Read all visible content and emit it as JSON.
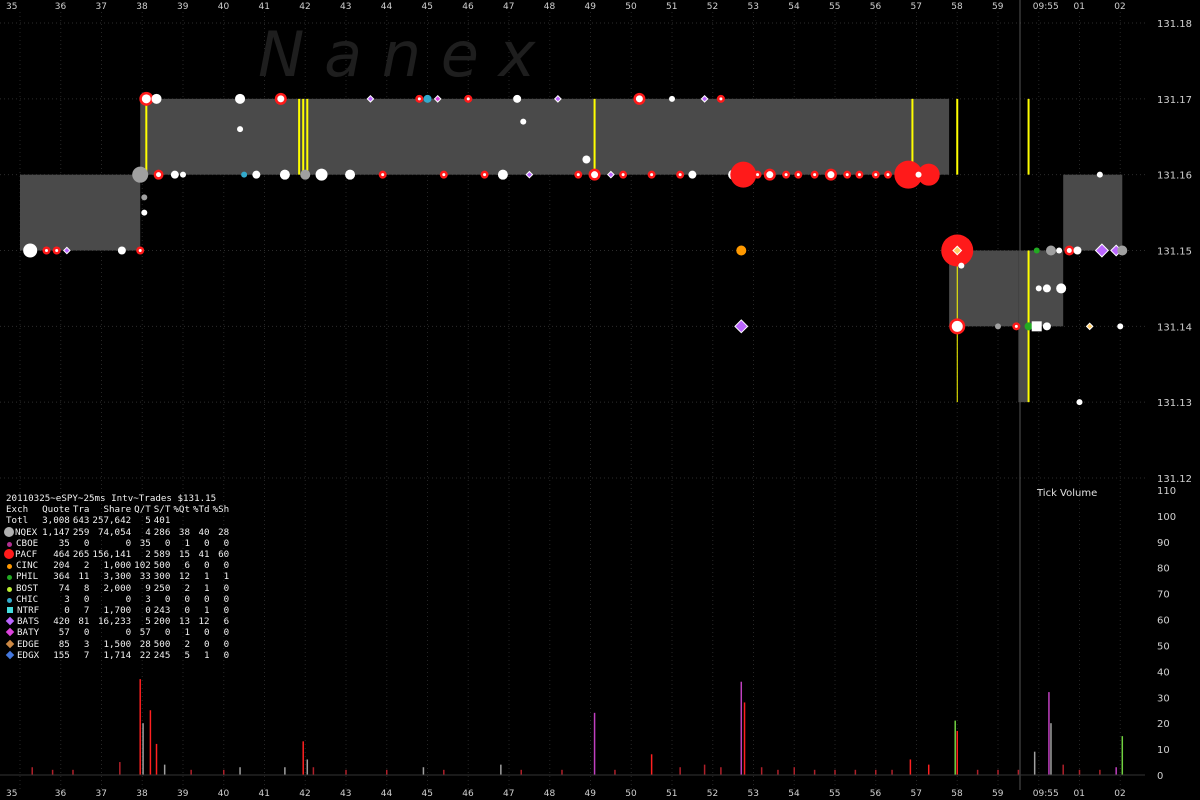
{
  "chart_data": {
    "type": "scatter",
    "watermark": "N a n e x",
    "y_price_ticks": [
      "131.18",
      "131.17",
      "131.16",
      "131.15",
      "131.14",
      "131.13",
      "131.12"
    ],
    "ylim_price": [
      131.12,
      131.18
    ],
    "x_ticks": [
      "35",
      "36",
      "37",
      "38",
      "39",
      "40",
      "41",
      "42",
      "43",
      "44",
      "45",
      "46",
      "47",
      "48",
      "49",
      "50",
      "51",
      "52",
      "53",
      "54",
      "55",
      "56",
      "57",
      "58",
      "59",
      "09:55",
      "01",
      "02"
    ],
    "y_volume_ticks": [
      "110",
      "100",
      "90",
      "80",
      "70",
      "60",
      "50",
      "40",
      "30",
      "20",
      "10",
      "0"
    ],
    "ylim_volume": [
      0,
      110
    ],
    "volume_label": "Tick Volume",
    "nbbo_bands": [
      {
        "x0": 0,
        "x1": 2.95,
        "bid": 131.15,
        "ask": 131.16
      },
      {
        "x0": 2.95,
        "x1": 22.8,
        "bid": 131.16,
        "ask": 131.17
      },
      {
        "x0": 22.8,
        "x1": 24.5,
        "bid": 131.14,
        "ask": 131.15
      },
      {
        "x0": 24.5,
        "x1": 24.75,
        "bid": 131.13,
        "ask": 131.15
      },
      {
        "x0": 24.75,
        "x1": 25.6,
        "bid": 131.14,
        "ask": 131.15
      },
      {
        "x0": 25.6,
        "x1": 27.05,
        "bid": 131.15,
        "ask": 131.16
      }
    ],
    "yellow_trades": [
      3.1,
      6.85,
      6.95,
      7.05,
      14.1,
      21.9,
      23.0,
      24.75
    ],
    "trades": [
      {
        "x": 0.25,
        "y": 131.15,
        "ex": "NQEX",
        "r": 7
      },
      {
        "x": 0.65,
        "y": 131.15,
        "ex": "PACF",
        "r": 3
      },
      {
        "x": 0.9,
        "y": 131.15,
        "ex": "PACF",
        "r": 3
      },
      {
        "x": 1.15,
        "y": 131.15,
        "ex": "BATS",
        "r": 3
      },
      {
        "x": 2.5,
        "y": 131.15,
        "ex": "NQEX",
        "r": 4
      },
      {
        "x": 2.95,
        "y": 131.15,
        "ex": "PACF",
        "r": 3
      },
      {
        "x": 2.95,
        "y": 131.16,
        "ex": "Totl",
        "r": 8
      },
      {
        "x": 3.05,
        "y": 131.157,
        "ex": "Totl",
        "r": 3
      },
      {
        "x": 3.05,
        "y": 131.155,
        "ex": "NQEX",
        "r": 3
      },
      {
        "x": 3.1,
        "y": 131.17,
        "ex": "PACF",
        "r": 6
      },
      {
        "x": 3.35,
        "y": 131.17,
        "ex": "NQEX",
        "r": 5
      },
      {
        "x": 3.4,
        "y": 131.16,
        "ex": "PACF",
        "r": 4
      },
      {
        "x": 3.8,
        "y": 131.16,
        "ex": "NQEX",
        "r": 4
      },
      {
        "x": 4.0,
        "y": 131.16,
        "ex": "NQEX",
        "r": 3
      },
      {
        "x": 5.4,
        "y": 131.17,
        "ex": "NQEX",
        "r": 5
      },
      {
        "x": 5.4,
        "y": 131.166,
        "ex": "NQEX",
        "r": 3
      },
      {
        "x": 5.5,
        "y": 131.16,
        "ex": "CHIC",
        "r": 3
      },
      {
        "x": 5.8,
        "y": 131.16,
        "ex": "NQEX",
        "r": 4
      },
      {
        "x": 6.4,
        "y": 131.17,
        "ex": "PACF",
        "r": 5
      },
      {
        "x": 6.5,
        "y": 131.16,
        "ex": "NQEX",
        "r": 5
      },
      {
        "x": 7.0,
        "y": 131.16,
        "ex": "Totl",
        "r": 5
      },
      {
        "x": 7.4,
        "y": 131.16,
        "ex": "NQEX",
        "r": 6
      },
      {
        "x": 8.1,
        "y": 131.16,
        "ex": "NQEX",
        "r": 5
      },
      {
        "x": 8.6,
        "y": 131.17,
        "ex": "BATS",
        "r": 3
      },
      {
        "x": 8.9,
        "y": 131.16,
        "ex": "PACF",
        "r": 3
      },
      {
        "x": 9.8,
        "y": 131.17,
        "ex": "PACF",
        "r": 3
      },
      {
        "x": 10.0,
        "y": 131.17,
        "ex": "CHIC",
        "r": 4
      },
      {
        "x": 10.25,
        "y": 131.17,
        "ex": "BATY",
        "r": 3
      },
      {
        "x": 10.4,
        "y": 131.16,
        "ex": "PACF",
        "r": 3
      },
      {
        "x": 11.0,
        "y": 131.17,
        "ex": "PACF",
        "r": 3
      },
      {
        "x": 11.4,
        "y": 131.16,
        "ex": "PACF",
        "r": 3
      },
      {
        "x": 11.85,
        "y": 131.16,
        "ex": "NQEX",
        "r": 5
      },
      {
        "x": 12.2,
        "y": 131.17,
        "ex": "NQEX",
        "r": 4
      },
      {
        "x": 12.35,
        "y": 131.167,
        "ex": "NQEX",
        "r": 3
      },
      {
        "x": 12.5,
        "y": 131.16,
        "ex": "BATS",
        "r": 3
      },
      {
        "x": 13.2,
        "y": 131.17,
        "ex": "BATS",
        "r": 3
      },
      {
        "x": 13.9,
        "y": 131.162,
        "ex": "NQEX",
        "r": 4
      },
      {
        "x": 13.7,
        "y": 131.16,
        "ex": "PACF",
        "r": 3
      },
      {
        "x": 14.1,
        "y": 131.16,
        "ex": "PACF",
        "r": 5
      },
      {
        "x": 14.5,
        "y": 131.16,
        "ex": "BATS",
        "r": 3
      },
      {
        "x": 14.8,
        "y": 131.16,
        "ex": "PACF",
        "r": 3
      },
      {
        "x": 15.2,
        "y": 131.17,
        "ex": "PACF",
        "r": 5
      },
      {
        "x": 15.5,
        "y": 131.16,
        "ex": "PACF",
        "r": 3
      },
      {
        "x": 16.0,
        "y": 131.17,
        "ex": "NQEX",
        "r": 3
      },
      {
        "x": 16.2,
        "y": 131.16,
        "ex": "PACF",
        "r": 3
      },
      {
        "x": 16.5,
        "y": 131.16,
        "ex": "NQEX",
        "r": 4
      },
      {
        "x": 16.8,
        "y": 131.17,
        "ex": "BATS",
        "r": 3
      },
      {
        "x": 17.2,
        "y": 131.17,
        "ex": "PACF",
        "r": 3
      },
      {
        "x": 17.5,
        "y": 131.16,
        "ex": "NQEX",
        "r": 5
      },
      {
        "x": 17.75,
        "y": 131.16,
        "ex": "PACF",
        "r": 13
      },
      {
        "x": 17.7,
        "y": 131.15,
        "ex": "CINC",
        "r": 5
      },
      {
        "x": 17.7,
        "y": 131.14,
        "ex": "BATS",
        "r": 6
      },
      {
        "x": 18.1,
        "y": 131.16,
        "ex": "PACF",
        "r": 3
      },
      {
        "x": 18.4,
        "y": 131.16,
        "ex": "PACF",
        "r": 5
      },
      {
        "x": 18.8,
        "y": 131.16,
        "ex": "PACF",
        "r": 3
      },
      {
        "x": 19.1,
        "y": 131.16,
        "ex": "PACF",
        "r": 3
      },
      {
        "x": 19.5,
        "y": 131.16,
        "ex": "PACF",
        "r": 3
      },
      {
        "x": 19.9,
        "y": 131.16,
        "ex": "PACF",
        "r": 5
      },
      {
        "x": 20.3,
        "y": 131.16,
        "ex": "PACF",
        "r": 3
      },
      {
        "x": 20.6,
        "y": 131.16,
        "ex": "PACF",
        "r": 3
      },
      {
        "x": 21.0,
        "y": 131.16,
        "ex": "PACF",
        "r": 3
      },
      {
        "x": 21.3,
        "y": 131.16,
        "ex": "PACF",
        "r": 3
      },
      {
        "x": 21.8,
        "y": 131.16,
        "ex": "PACF",
        "r": 14
      },
      {
        "x": 22.3,
        "y": 131.16,
        "ex": "PACF",
        "r": 11
      },
      {
        "x": 22.05,
        "y": 131.16,
        "ex": "NQEX",
        "r": 3
      },
      {
        "x": 23.0,
        "y": 131.15,
        "ex": "PACF",
        "r": 16
      },
      {
        "x": 23.0,
        "y": 131.15,
        "ex": "EDGE",
        "r": 4
      },
      {
        "x": 23.0,
        "y": 131.14,
        "ex": "PACF",
        "r": 7
      },
      {
        "x": 23.1,
        "y": 131.148,
        "ex": "NQEX",
        "r": 3
      },
      {
        "x": 24.0,
        "y": 131.14,
        "ex": "Totl",
        "r": 3
      },
      {
        "x": 24.45,
        "y": 131.14,
        "ex": "PACF",
        "r": 3
      },
      {
        "x": 24.75,
        "y": 131.14,
        "ex": "PHIL",
        "r": 4
      },
      {
        "x": 24.95,
        "y": 131.14,
        "ex": "NTRF",
        "r": 5
      },
      {
        "x": 25.2,
        "y": 131.14,
        "ex": "NQEX",
        "r": 4
      },
      {
        "x": 24.95,
        "y": 131.15,
        "ex": "PHIL",
        "r": 3
      },
      {
        "x": 25.3,
        "y": 131.15,
        "ex": "Totl",
        "r": 5
      },
      {
        "x": 25.0,
        "y": 131.145,
        "ex": "NQEX",
        "r": 3
      },
      {
        "x": 25.2,
        "y": 131.145,
        "ex": "NQEX",
        "r": 4
      },
      {
        "x": 25.55,
        "y": 131.145,
        "ex": "NQEX",
        "r": 5
      },
      {
        "x": 25.75,
        "y": 131.15,
        "ex": "PACF",
        "r": 4
      },
      {
        "x": 25.5,
        "y": 131.15,
        "ex": "NQEX",
        "r": 3
      },
      {
        "x": 25.95,
        "y": 131.15,
        "ex": "NQEX",
        "r": 4
      },
      {
        "x": 26.25,
        "y": 131.14,
        "ex": "EDGE",
        "r": 3
      },
      {
        "x": 26.5,
        "y": 131.16,
        "ex": "NQEX",
        "r": 3
      },
      {
        "x": 26.55,
        "y": 131.15,
        "ex": "BATS",
        "r": 6
      },
      {
        "x": 26.9,
        "y": 131.15,
        "ex": "BATS",
        "r": 5
      },
      {
        "x": 27.05,
        "y": 131.15,
        "ex": "Totl",
        "r": 5
      },
      {
        "x": 26.0,
        "y": 131.13,
        "ex": "NQEX",
        "r": 3
      },
      {
        "x": 27.0,
        "y": 131.14,
        "ex": "NQEX",
        "r": 3
      }
    ],
    "volume_spikes": [
      {
        "x": 0.3,
        "v": 3,
        "c": "#b0202a"
      },
      {
        "x": 0.8,
        "v": 2,
        "c": "#b0202a"
      },
      {
        "x": 1.3,
        "v": 2,
        "c": "#b0202a"
      },
      {
        "x": 2.45,
        "v": 5,
        "c": "#b0202a"
      },
      {
        "x": 2.95,
        "v": 37,
        "c": "#ff2020"
      },
      {
        "x": 3.02,
        "v": 20,
        "c": "#a0a0a0"
      },
      {
        "x": 3.2,
        "v": 25,
        "c": "#ff2020"
      },
      {
        "x": 3.35,
        "v": 12,
        "c": "#ff2020"
      },
      {
        "x": 3.55,
        "v": 4,
        "c": "#a0a0a0"
      },
      {
        "x": 4.2,
        "v": 2,
        "c": "#b0202a"
      },
      {
        "x": 5.0,
        "v": 2,
        "c": "#b0202a"
      },
      {
        "x": 5.4,
        "v": 3,
        "c": "#a0a0a0"
      },
      {
        "x": 6.5,
        "v": 3,
        "c": "#a0a0a0"
      },
      {
        "x": 6.95,
        "v": 13,
        "c": "#ff2020"
      },
      {
        "x": 7.05,
        "v": 6,
        "c": "#a0a0a0"
      },
      {
        "x": 7.2,
        "v": 3,
        "c": "#b0202a"
      },
      {
        "x": 8.0,
        "v": 2,
        "c": "#b0202a"
      },
      {
        "x": 9.0,
        "v": 2,
        "c": "#b0202a"
      },
      {
        "x": 9.9,
        "v": 3,
        "c": "#a0a0a0"
      },
      {
        "x": 10.4,
        "v": 2,
        "c": "#b0202a"
      },
      {
        "x": 11.8,
        "v": 4,
        "c": "#a0a0a0"
      },
      {
        "x": 12.3,
        "v": 2,
        "c": "#b0202a"
      },
      {
        "x": 13.3,
        "v": 2,
        "c": "#b0202a"
      },
      {
        "x": 14.1,
        "v": 24,
        "c": "#c040c0"
      },
      {
        "x": 14.6,
        "v": 2,
        "c": "#b0202a"
      },
      {
        "x": 15.5,
        "v": 8,
        "c": "#ff2020"
      },
      {
        "x": 16.2,
        "v": 3,
        "c": "#b0202a"
      },
      {
        "x": 16.8,
        "v": 4,
        "c": "#b0202a"
      },
      {
        "x": 17.2,
        "v": 3,
        "c": "#b0202a"
      },
      {
        "x": 17.7,
        "v": 36,
        "c": "#c040c0"
      },
      {
        "x": 17.78,
        "v": 28,
        "c": "#ff2020"
      },
      {
        "x": 18.2,
        "v": 3,
        "c": "#b0202a"
      },
      {
        "x": 18.6,
        "v": 2,
        "c": "#b0202a"
      },
      {
        "x": 19.0,
        "v": 3,
        "c": "#b0202a"
      },
      {
        "x": 19.5,
        "v": 2,
        "c": "#b0202a"
      },
      {
        "x": 20.0,
        "v": 2,
        "c": "#b0202a"
      },
      {
        "x": 20.5,
        "v": 2,
        "c": "#b0202a"
      },
      {
        "x": 21.0,
        "v": 2,
        "c": "#b0202a"
      },
      {
        "x": 21.4,
        "v": 2,
        "c": "#b0202a"
      },
      {
        "x": 21.85,
        "v": 6,
        "c": "#ff2020"
      },
      {
        "x": 22.3,
        "v": 4,
        "c": "#ff2020"
      },
      {
        "x": 22.95,
        "v": 21,
        "c": "#70d040"
      },
      {
        "x": 23.0,
        "v": 17,
        "c": "#ff2020"
      },
      {
        "x": 23.5,
        "v": 2,
        "c": "#b0202a"
      },
      {
        "x": 24.0,
        "v": 2,
        "c": "#b0202a"
      },
      {
        "x": 24.5,
        "v": 2,
        "c": "#b0202a"
      },
      {
        "x": 24.9,
        "v": 9,
        "c": "#a0a0a0"
      },
      {
        "x": 25.25,
        "v": 32,
        "c": "#c040c0"
      },
      {
        "x": 25.3,
        "v": 20,
        "c": "#a0a0a0"
      },
      {
        "x": 25.6,
        "v": 4,
        "c": "#b0202a"
      },
      {
        "x": 26.0,
        "v": 2,
        "c": "#b0202a"
      },
      {
        "x": 26.5,
        "v": 2,
        "c": "#b0202a"
      },
      {
        "x": 26.9,
        "v": 3,
        "c": "#c040c0"
      },
      {
        "x": 27.05,
        "v": 15,
        "c": "#70d040"
      }
    ]
  },
  "stats": {
    "title": "20110325~eSPY~25ms Intv~Trades $131.15",
    "columns": [
      "Exch",
      "Quote",
      "Tra",
      "Share",
      "Q/T",
      "S/T",
      "%Qt",
      "%Td",
      "%Sh"
    ],
    "rows": [
      {
        "exch": "Totl",
        "quote": "3,008",
        "tra": "643",
        "share": "257,642",
        "qt": "5",
        "st": "401",
        "pq": "",
        "pt": "",
        "ps": "",
        "color": "",
        "marker": "none"
      },
      {
        "exch": "NQEX",
        "quote": "1,147",
        "tra": "259",
        "share": "74,054",
        "qt": "4",
        "st": "286",
        "pq": "38",
        "pt": "40",
        "ps": "28",
        "color": "#b0b0b0",
        "marker": "bigdot"
      },
      {
        "exch": "CBOE",
        "quote": "35",
        "tra": "0",
        "share": "0",
        "qt": "35",
        "st": "0",
        "pq": "1",
        "pt": "0",
        "ps": "0",
        "color": "#b03090",
        "marker": "dot"
      },
      {
        "exch": "PACF",
        "quote": "464",
        "tra": "265",
        "share": "156,141",
        "qt": "2",
        "st": "589",
        "pq": "15",
        "pt": "41",
        "ps": "60",
        "color": "#ff1a1a",
        "marker": "bigdot"
      },
      {
        "exch": "CINC",
        "quote": "204",
        "tra": "2",
        "share": "1,000",
        "qt": "102",
        "st": "500",
        "pq": "6",
        "pt": "0",
        "ps": "0",
        "color": "#ff9900",
        "marker": "dot"
      },
      {
        "exch": "PHIL",
        "quote": "364",
        "tra": "11",
        "share": "3,300",
        "qt": "33",
        "st": "300",
        "pq": "12",
        "pt": "1",
        "ps": "1",
        "color": "#22aa22",
        "marker": "dot"
      },
      {
        "exch": "BOST",
        "quote": "74",
        "tra": "8",
        "share": "2,000",
        "qt": "9",
        "st": "250",
        "pq": "2",
        "pt": "1",
        "ps": "0",
        "color": "#bbee33",
        "marker": "dot"
      },
      {
        "exch": "CHIC",
        "quote": "3",
        "tra": "0",
        "share": "0",
        "qt": "3",
        "st": "0",
        "pq": "0",
        "pt": "0",
        "ps": "0",
        "color": "#33aacc",
        "marker": "dot"
      },
      {
        "exch": "NTRF",
        "quote": "0",
        "tra": "7",
        "share": "1,700",
        "qt": "0",
        "st": "243",
        "pq": "0",
        "pt": "1",
        "ps": "0",
        "color": "#44dddd",
        "marker": "square"
      },
      {
        "exch": "BATS",
        "quote": "420",
        "tra": "81",
        "share": "16,233",
        "qt": "5",
        "st": "200",
        "pq": "13",
        "pt": "12",
        "ps": "6",
        "color": "#bb66ff",
        "marker": "diamond"
      },
      {
        "exch": "BATY",
        "quote": "57",
        "tra": "0",
        "share": "0",
        "qt": "57",
        "st": "0",
        "pq": "1",
        "pt": "0",
        "ps": "0",
        "color": "#dd44dd",
        "marker": "diamond"
      },
      {
        "exch": "EDGE",
        "quote": "85",
        "tra": "3",
        "share": "1,500",
        "qt": "28",
        "st": "500",
        "pq": "2",
        "pt": "0",
        "ps": "0",
        "color": "#cc8844",
        "marker": "diamond"
      },
      {
        "exch": "EDGX",
        "quote": "155",
        "tra": "7",
        "share": "1,714",
        "qt": "22",
        "st": "245",
        "pq": "5",
        "pt": "1",
        "ps": "0",
        "color": "#4477dd",
        "marker": "diamond"
      }
    ]
  },
  "colors": {
    "band": "#4a4a4a",
    "grid": "#2a2a2a",
    "yellow": "#ffff00",
    "NQEX": "#ffffff",
    "Totl": "#a0a0a0",
    "PACF": "#ff1a1a",
    "CINC": "#ff9900",
    "PHIL": "#22aa22",
    "CHIC": "#33aacc",
    "NTRF": "#44dddd",
    "BATS": "#bb66ff",
    "BATY": "#dd44dd",
    "EDGE": "#ffcc66"
  }
}
